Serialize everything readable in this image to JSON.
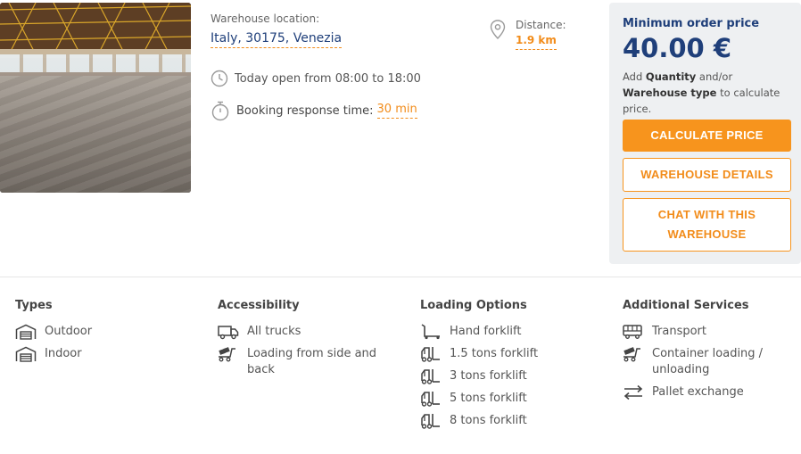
{
  "listing": {
    "location_label": "Warehouse location:",
    "location_value": "Italy, 30175, Venezia",
    "hours": "Today open from 08:00 to 18:00",
    "booking_label": "Booking response time:",
    "booking_value": "30 min",
    "distance_label": "Distance:",
    "distance_value": "1.9 km"
  },
  "pricing": {
    "label": "Minimum order price",
    "value": "40.00 €",
    "note_prefix": "Add ",
    "note_quantity": "Quantity",
    "note_middle": " and/or ",
    "note_type": "Warehouse type",
    "note_suffix": " to calculate price.",
    "calculate_button": "CALCULATE PRICE",
    "details_button": "WAREHOUSE DETAILS",
    "chat_button": "CHAT WITH THIS WAREHOUSE"
  },
  "features": {
    "types": {
      "title": "Types",
      "items": [
        {
          "label": "Outdoor",
          "icon": "warehouse-icon"
        },
        {
          "label": "Indoor",
          "icon": "warehouse-icon"
        }
      ]
    },
    "accessibility": {
      "title": "Accessibility",
      "items": [
        {
          "label": "All trucks",
          "icon": "truck-icon"
        },
        {
          "label": "Loading from side and back",
          "icon": "loading-dolly-icon"
        }
      ]
    },
    "loading": {
      "title": "Loading Options",
      "items": [
        {
          "label": "Hand forklift",
          "icon": "hand-forklift-icon"
        },
        {
          "label": "1.5 tons forklift",
          "icon": "forklift-icon"
        },
        {
          "label": "3 tons forklift",
          "icon": "forklift-icon"
        },
        {
          "label": "5 tons forklift",
          "icon": "forklift-icon"
        },
        {
          "label": "8 tons forklift",
          "icon": "forklift-icon"
        }
      ]
    },
    "services": {
      "title": "Additional Services",
      "items": [
        {
          "label": "Transport",
          "icon": "bus-icon"
        },
        {
          "label": "Container loading / unloading",
          "icon": "loading-dolly-icon"
        },
        {
          "label": "Pallet exchange",
          "icon": "exchange-arrows-icon"
        }
      ]
    }
  },
  "colors": {
    "accent": "#f7941d",
    "brand_blue": "#1f3f7a",
    "panel_bg": "#eef0f2"
  }
}
